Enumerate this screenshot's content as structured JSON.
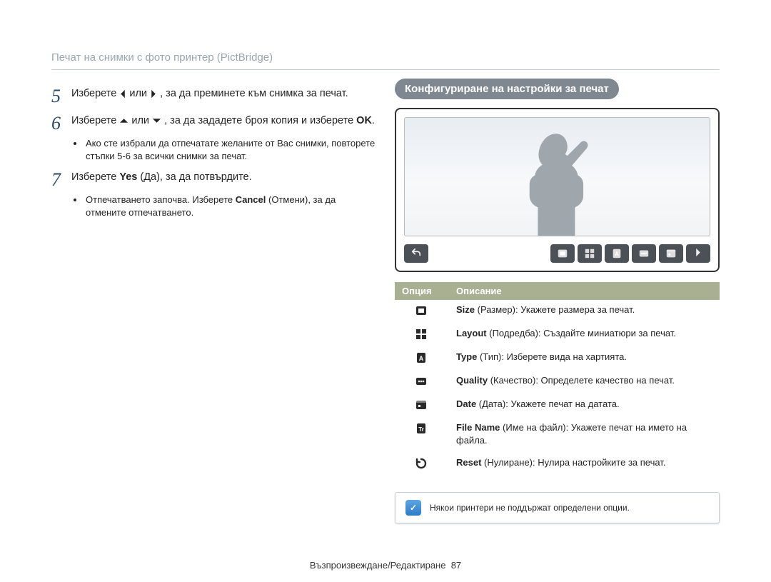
{
  "breadcrumb": "Печат на снимки с фото принтер (PictBridge)",
  "steps": [
    {
      "num": "5",
      "pre": "Изберете ",
      "mid": " или ",
      "post": ", за да преминете към снимка за печат.",
      "subs": []
    },
    {
      "num": "6",
      "pre": "Изберете ",
      "mid": " или ",
      "post_before_ok": ", за да зададете броя копия и изберете ",
      "post_after_ok": ".",
      "ok_label": "OK",
      "subs": [
        "Ако сте избрали да отпечатате желаните от Вас снимки, повторете стъпки 5-6 за всички снимки за печат."
      ]
    },
    {
      "num": "7",
      "text_plain_pre": "Изберете ",
      "bold1": "Yes",
      "text_plain_post": " (Да), за да потвърдите.",
      "subs_rich": {
        "pre": "Отпечатването започва. Изберете ",
        "bold": "Cancel",
        "post": " (Отмени), за да отмените отпечатването."
      }
    }
  ],
  "right": {
    "pill": "Конфигуриране на настройки за печат",
    "table_head": {
      "col1": "Опция",
      "col2": "Описание"
    },
    "rows": [
      {
        "icon": "size-icon",
        "bold": "Size",
        "paren": "(Размер)",
        "desc": ": Укажете размера за печат."
      },
      {
        "icon": "layout-icon",
        "bold": "Layout",
        "paren": "(Подредба)",
        "desc": ": Създайте миниатюри за печат."
      },
      {
        "icon": "type-icon",
        "bold": "Type",
        "paren": "(Тип)",
        "desc": ": Изберете вида на хартията."
      },
      {
        "icon": "quality-icon",
        "bold": "Quality",
        "paren": "(Качество)",
        "desc": ": Определете качество на печат."
      },
      {
        "icon": "date-icon",
        "bold": "Date",
        "paren": "(Дата)",
        "desc": ": Укажете печат на датата."
      },
      {
        "icon": "filename-icon",
        "bold": "File Name",
        "paren": "(Име на файл)",
        "desc": ": Укажете печат на името на файла."
      },
      {
        "icon": "reset-icon",
        "bold": "Reset",
        "paren": "(Нулиране)",
        "desc": ": Нулира настройките за печат."
      }
    ],
    "note": "Някои принтери не поддържат определени опции."
  },
  "footer": {
    "section": "Възпроизвеждане/Редактиране",
    "page": "87"
  }
}
